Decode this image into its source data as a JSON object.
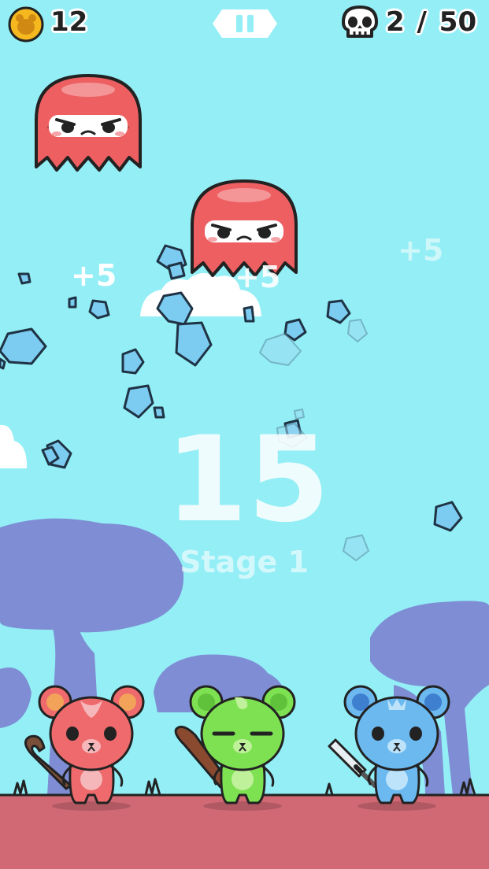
{
  "hud": {
    "coin_count": "12",
    "kills_current": "2",
    "kills_separator": "/",
    "kills_total": "50"
  },
  "center": {
    "big_number": "15",
    "stage_label": "Stage 1"
  },
  "popups": [
    "+5",
    "+5",
    "+5"
  ],
  "colors": {
    "sky": "#93EEF6",
    "ground": "#D16975",
    "tree": "#7F8ED4",
    "ghost": "#EE5F62",
    "gem": "#7CCBF0",
    "bear_red": "#EE6A6C",
    "bear_green": "#7EE152",
    "bear_blue": "#6CB9F0"
  },
  "icons": {
    "coin": "bear-coin-icon",
    "pause": "pause-icon",
    "skull": "skull-icon"
  }
}
